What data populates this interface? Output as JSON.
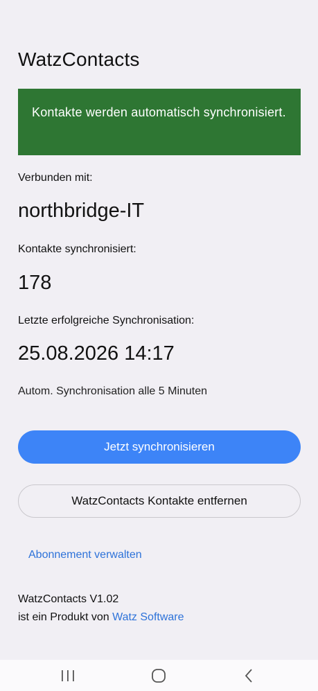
{
  "app": {
    "title": "WatzContacts"
  },
  "status": {
    "message": "Kontakte werden automatisch synchronisiert.",
    "color": "#2e7633"
  },
  "connection": {
    "label": "Verbunden mit:",
    "value": "northbridge-IT"
  },
  "contacts": {
    "label": "Kontakte synchronisiert:",
    "value": "178"
  },
  "last_sync": {
    "label": "Letzte erfolgreiche Synchronisation:",
    "value": "25.08.2026 14:17"
  },
  "auto_sync": {
    "text": "Autom. Synchronisation alle 5 Minuten"
  },
  "actions": {
    "sync_now_label": "Jetzt synchronisieren",
    "remove_contacts_label": "WatzContacts Kontakte entfernen",
    "manage_subscription_label": "Abonnement verwalten",
    "accent_color": "#3d84f7"
  },
  "footer": {
    "version_line": "WatzContacts V1.02",
    "product_prefix": "ist ein Produkt von ",
    "company_link": "Watz Software"
  },
  "navigation": {
    "recent_icon": "recent-apps-icon",
    "home_icon": "home-icon",
    "back_icon": "back-icon"
  }
}
